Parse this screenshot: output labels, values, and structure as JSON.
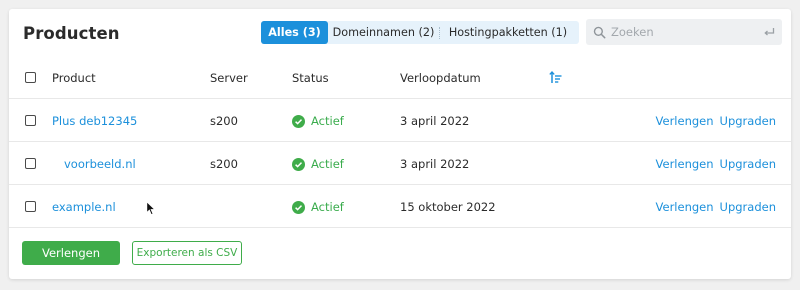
{
  "page": {
    "title": "Producten"
  },
  "filters": {
    "tabs": [
      {
        "label": "Alles (3)",
        "active": true
      },
      {
        "label": "Domeinnamen (2)",
        "active": false
      },
      {
        "label": "Hostingpakketten (1)",
        "active": false
      }
    ]
  },
  "search": {
    "placeholder": "Zoeken",
    "value": ""
  },
  "table": {
    "columns": [
      "Product",
      "Server",
      "Status",
      "Verloopdatum"
    ],
    "rows": [
      {
        "product": "Plus deb12345",
        "server": "s200",
        "status": "Actief",
        "expiry": "3 april 2022",
        "actions": [
          "Verlengen",
          "Upgraden"
        ]
      },
      {
        "product": "voorbeeld.nl",
        "server": "s200",
        "status": "Actief",
        "expiry": "3 april 2022",
        "actions": [
          "Verlengen",
          "Upgraden"
        ]
      },
      {
        "product": "example.nl",
        "server": "",
        "status": "Actief",
        "expiry": "15 oktober 2022",
        "actions": [
          "Verlengen",
          "Upgraden"
        ]
      }
    ]
  },
  "footer": {
    "primary_button": "Verlengen",
    "secondary_button": "Exporteren als CSV"
  },
  "colors": {
    "accent": "#1c90db",
    "success": "#3fac4a",
    "status_text": "#3aac4d"
  },
  "icons": [
    "search-icon",
    "enter-key-icon",
    "sort-descending-icon",
    "check-circle-icon",
    "mouse-pointer-icon"
  ]
}
